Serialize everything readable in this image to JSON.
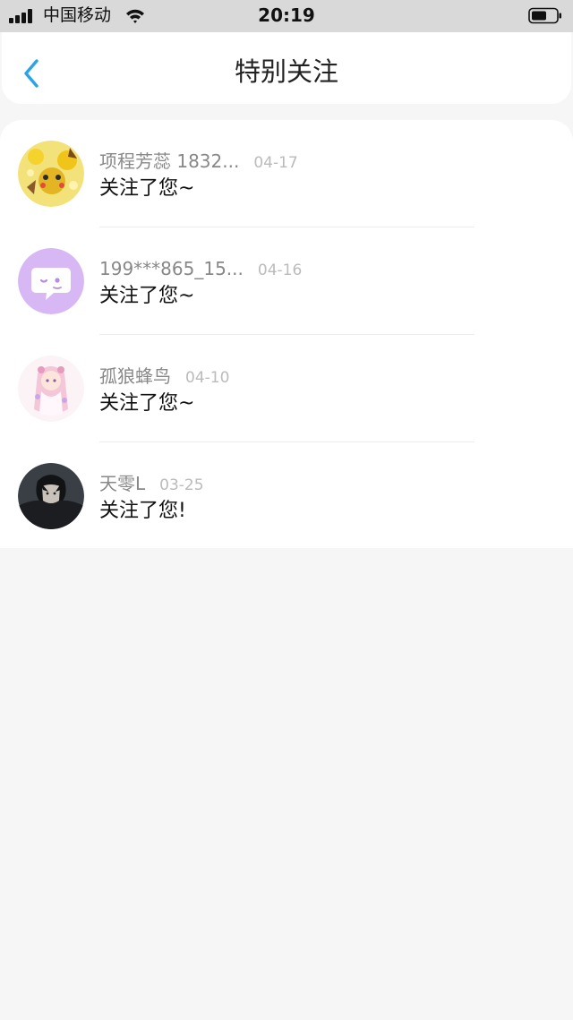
{
  "status_bar": {
    "carrier": "中国移动",
    "time": "20:19",
    "icons": [
      "signal-icon",
      "wifi-icon",
      "battery-icon"
    ]
  },
  "nav": {
    "back_icon": "chevron-left-icon",
    "title": "特别关注"
  },
  "colors": {
    "accent": "#2aa3e8",
    "background": "#f6f6f6",
    "card": "#ffffff",
    "name_text": "#888888",
    "date_text": "#bbbbbb"
  },
  "items": [
    {
      "name": "项程芳蕊 1832...",
      "date": "04-17",
      "message": "关注了您~",
      "avatar": "avatar-yellow-cartoon"
    },
    {
      "name": "199***865_15...",
      "date": "04-16",
      "message": "关注了您~",
      "avatar": "avatar-default-chat-bubble"
    },
    {
      "name": "孤狼蜂鸟",
      "date": "04-10",
      "message": "关注了您~",
      "avatar": "avatar-pink-anime-girl"
    },
    {
      "name": "天零L",
      "date": "03-25",
      "message": "关注了您!",
      "avatar": "avatar-dark-portrait"
    }
  ]
}
